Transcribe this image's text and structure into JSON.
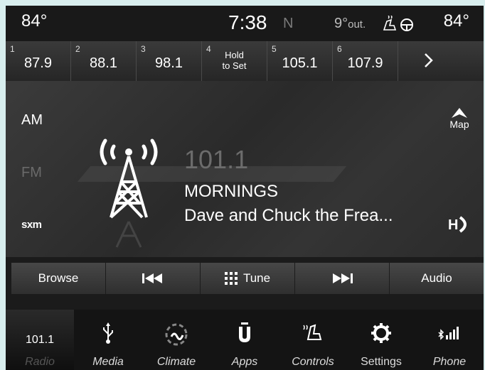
{
  "status": {
    "temp_left": "84°",
    "clock": "7:38",
    "compass": "N",
    "outside_temp": "9°",
    "outside_suffix": "out.",
    "temp_right": "84°"
  },
  "presets": [
    {
      "num": "1",
      "freq": "87.9"
    },
    {
      "num": "2",
      "freq": "88.1"
    },
    {
      "num": "3",
      "freq": "98.1"
    },
    {
      "num": "4",
      "hold_line1": "Hold",
      "hold_line2": "to Set"
    },
    {
      "num": "5",
      "freq": "105.1"
    },
    {
      "num": "6",
      "freq": "107.9"
    }
  ],
  "bands": {
    "am": "AM",
    "fm": "FM",
    "sxm": "sxm"
  },
  "station": {
    "frequency": "101.1",
    "name": "MORNINGS",
    "info": "Dave and Chuck the Frea..."
  },
  "map_label": "Map",
  "controls": {
    "browse": "Browse",
    "tune": "Tune",
    "audio": "Audio"
  },
  "nav": {
    "radio_freq": "101.1",
    "radio": "Radio",
    "media": "Media",
    "climate": "Climate",
    "apps": "Apps",
    "controls": "Controls",
    "settings": "Settings",
    "phone": "Phone"
  },
  "colors": {
    "background": "#1b1b1b",
    "inactive_text": "#6a6a6a",
    "frame": "#d8eeee"
  }
}
